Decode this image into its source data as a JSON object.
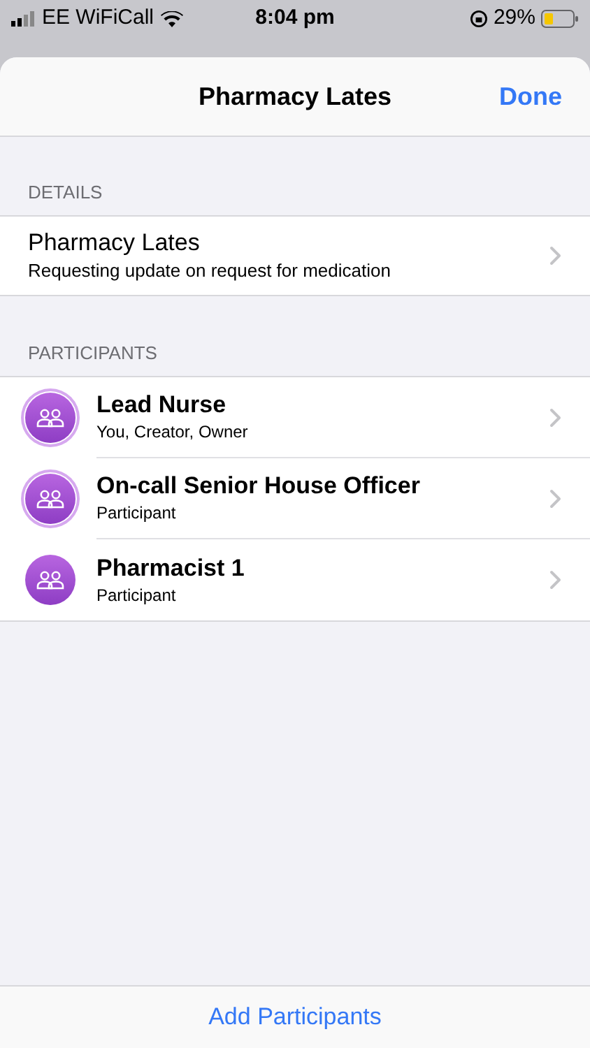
{
  "status_bar": {
    "carrier": "EE WiFiCall",
    "time": "8:04 pm",
    "battery": "29%"
  },
  "sheet": {
    "title": "Pharmacy Lates",
    "done": "Done"
  },
  "details": {
    "header": "DETAILS",
    "title": "Pharmacy Lates",
    "subtitle": "Requesting update on request for medication"
  },
  "participants": {
    "header": "PARTICIPANTS",
    "items": [
      {
        "name": "Lead Nurse",
        "role": "You, Creator, Owner",
        "outlined": true
      },
      {
        "name": "On-call Senior House Officer",
        "role": "Participant",
        "outlined": true
      },
      {
        "name": "Pharmacist 1",
        "role": "Participant",
        "outlined": false
      }
    ]
  },
  "footer": {
    "action": "Add Participants"
  }
}
